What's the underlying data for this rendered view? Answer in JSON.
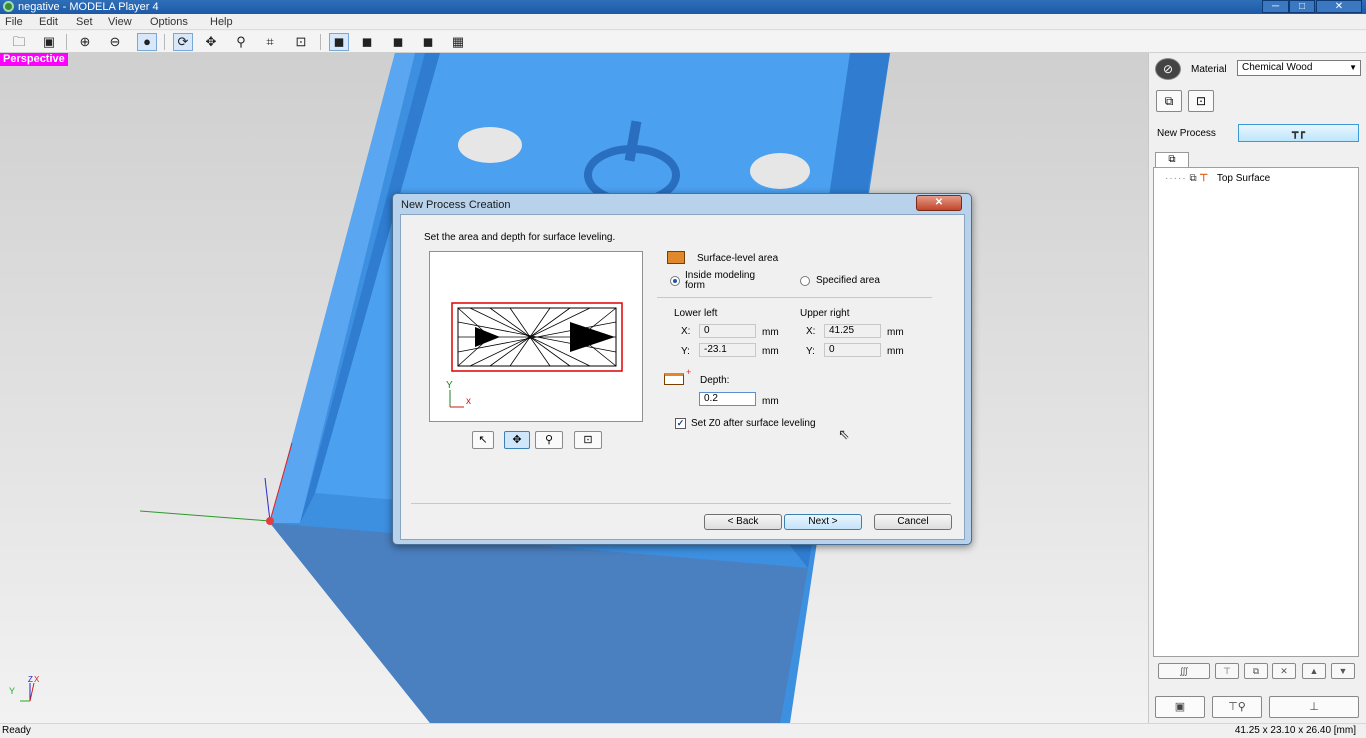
{
  "window": {
    "title": "negative - MODELA Player 4",
    "min_glyph": "─",
    "max_glyph": "□",
    "close_glyph": "✕"
  },
  "menu": [
    "File",
    "Edit",
    "Set",
    "View",
    "Options",
    "Help"
  ],
  "viewport": {
    "label": "Perspective",
    "axis_z": "Z",
    "axis_x": "X",
    "axis_y": "Y"
  },
  "right_panel": {
    "material_label": "Material",
    "material_value": "Chemical Wood",
    "new_process_label": "New Process",
    "tree_items": [
      {
        "label": "Top Surface"
      }
    ]
  },
  "status": {
    "left": "Ready",
    "right": "41.25 x 23.10 x 26.40 [mm]"
  },
  "dialog": {
    "title": "New Process Creation",
    "close_glyph": "✕",
    "instruction": "Set the area and depth for surface leveling.",
    "section_title": "Surface-level area",
    "radio_inside": "Inside modeling form",
    "radio_specified": "Specified area",
    "selected_area": "inside",
    "lower_left": "Lower left",
    "upper_right": "Upper right",
    "x_label": "X:",
    "y_label": "Y:",
    "unit": "mm",
    "ll_x": "0",
    "ll_y": "-23.1",
    "ur_x": "41.25",
    "ur_y": "0",
    "depth_label": "Depth:",
    "depth_value": "0.2",
    "set_z0_label": "Set Z0 after surface leveling",
    "set_z0_checked": true,
    "preview_axis_y": "Y",
    "preview_axis_x": "x",
    "buttons": {
      "back": "< Back",
      "next": "Next >",
      "cancel": "Cancel"
    }
  },
  "colors": {
    "model": "#3d8fe0",
    "perspective_badge": "#ff00ff",
    "accent_orange": "#e0892c"
  }
}
